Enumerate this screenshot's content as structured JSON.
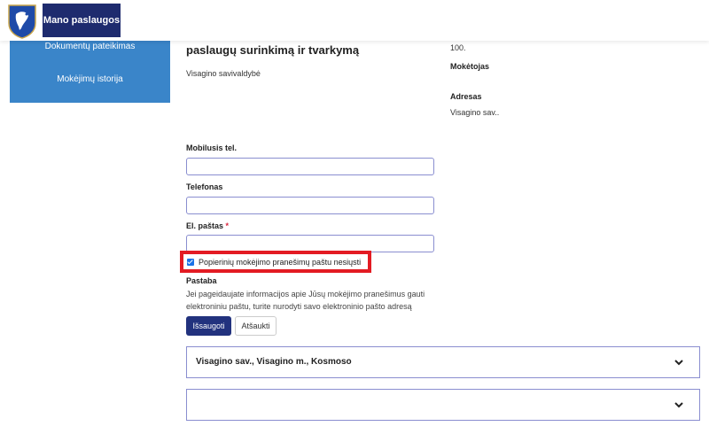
{
  "header": {
    "brand": "Mano paslaugos"
  },
  "sidebar": {
    "items": [
      {
        "label": "Dokumentų pateikimas"
      },
      {
        "label": "Mokėjimų istorija"
      }
    ]
  },
  "main": {
    "heading": "paslaugų surinkimą ir tvarkymą",
    "municipality": "Visagino savivaldybė"
  },
  "details": {
    "value_top": "100.",
    "payer_label": "Mokėtojas",
    "address_label": "Adresas",
    "address_value": "Visagino sav.."
  },
  "form": {
    "mobile_label": "Mobilusis tel.",
    "mobile_value": "",
    "phone_label": "Telefonas",
    "phone_value": "",
    "email_label": "El. paštas",
    "email_required": "*",
    "email_value": "",
    "checkbox_label": "Popierinių mokėjimo pranešimų paštu nesiųsti",
    "checkbox_checked": true,
    "note_label": "Pastaba",
    "hint": "Jei pageidaujate informacijos apie Jūsų mokėjimo pranešimus gauti elektroniniu paštu, turite nurodyti savo elektroninio pašto adresą",
    "save_label": "Išsaugoti",
    "cancel_label": "Atšaukti"
  },
  "panels": [
    {
      "title": "Visagino sav., Visagino m., Kosmoso"
    },
    {
      "title": ""
    }
  ],
  "colors": {
    "brand": "#1e2b6e",
    "sidebar": "#3a85c9",
    "primary_button": "#22327e",
    "highlight": "#e31b23",
    "required": "#d9233b"
  },
  "icons": {
    "crest": "crest-icon",
    "chevron": "chevron-down-icon"
  }
}
